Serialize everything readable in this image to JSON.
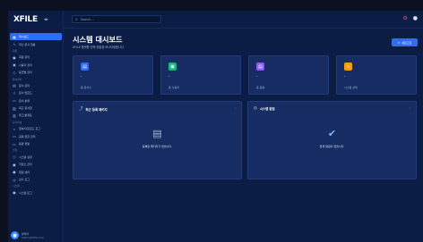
{
  "brand": {
    "logo": "XFILE",
    "toggle": "◂▸"
  },
  "sidebar": {
    "items": [
      {
        "kind": "item",
        "label": "대시보드",
        "icon": "grid-icon",
        "glyph": "▦",
        "active": true
      },
      {
        "kind": "item",
        "label": "최신 문서 현황",
        "icon": "activity-icon",
        "glyph": "∿"
      },
      {
        "kind": "section",
        "label": "회원"
      },
      {
        "kind": "item",
        "label": "회원 관리",
        "icon": "users-icon",
        "glyph": "●"
      },
      {
        "kind": "item",
        "label": "사용자 관리",
        "icon": "user-icon",
        "glyph": "▣"
      },
      {
        "kind": "item",
        "label": "등급별 관리",
        "icon": "shield-icon",
        "glyph": "◇"
      },
      {
        "kind": "section",
        "label": "문서관리"
      },
      {
        "kind": "item",
        "label": "문서 관리",
        "icon": "file-icon",
        "glyph": "▤"
      },
      {
        "kind": "item",
        "label": "문서 업로드",
        "icon": "upload-icon",
        "glyph": "⇧"
      },
      {
        "kind": "item",
        "label": "문서 분류",
        "icon": "folder-icon",
        "glyph": "▭"
      },
      {
        "kind": "item",
        "label": "최근 문서함",
        "icon": "recent-icon",
        "glyph": "▧"
      },
      {
        "kind": "item",
        "label": "태그/분류표",
        "icon": "tag-icon",
        "glyph": "▥"
      },
      {
        "kind": "section",
        "label": "모니터링"
      },
      {
        "kind": "item",
        "label": "접속/다운로드 로그",
        "icon": "search-icon",
        "glyph": "⌕"
      },
      {
        "kind": "item",
        "label": "공유/권한 관리",
        "icon": "share-icon",
        "glyph": "▭"
      },
      {
        "kind": "item",
        "label": "용량 현황",
        "icon": "storage-icon",
        "glyph": "▭"
      },
      {
        "kind": "section",
        "label": "설정"
      },
      {
        "kind": "item",
        "label": "시스템 설정",
        "icon": "settings-icon",
        "glyph": "◇"
      },
      {
        "kind": "item",
        "label": "저장소 관리",
        "icon": "database-icon",
        "glyph": "●"
      },
      {
        "kind": "item",
        "label": "알림 센터",
        "icon": "bell-icon",
        "glyph": "●"
      },
      {
        "kind": "item",
        "label": "감사 로그",
        "icon": "audit-icon",
        "glyph": "◎"
      },
      {
        "kind": "section",
        "label": "시스템"
      },
      {
        "kind": "item",
        "label": "시스템 로그",
        "icon": "system-icon",
        "glyph": "●"
      }
    ]
  },
  "profile": {
    "name": "관리자",
    "email": "admin@xfile.co.kr",
    "avatar": "●"
  },
  "topbar": {
    "search_placeholder": "Search...",
    "search_glyph": "⌕",
    "notify_glyph": "⚙",
    "menu_glyph": "●"
  },
  "page": {
    "title": "시스템 대시보드",
    "subtitle": "XFILE 플랫폼 전체 현황을 모니터링합니다.",
    "refresh_label": "새로고침",
    "refresh_glyph": "⟳"
  },
  "stats": [
    {
      "label": "총 문서수",
      "value": "-",
      "icon": "file-icon",
      "glyph": "▤",
      "color": "#2f6df6"
    },
    {
      "label": "총 사용자",
      "value": "-",
      "icon": "users-icon",
      "glyph": "▣",
      "color": "#10b981"
    },
    {
      "label": "총 용량",
      "value": "-",
      "icon": "storage-icon",
      "glyph": "▤",
      "color": "#8b5cf6"
    },
    {
      "label": "시스템 상태",
      "value": "-",
      "icon": "pulse-icon",
      "glyph": "∿",
      "color": "#f59e0b"
    }
  ],
  "panels": {
    "recent": {
      "title": "최근 등록 패키지",
      "glyph": "⤴",
      "more": "›",
      "empty_glyph": "▤",
      "empty_text": "등록된 패키지가 없습니다."
    },
    "alerts": {
      "title": "시스템 알림",
      "glyph": "◎",
      "more": "›",
      "empty_glyph": "✔",
      "empty_text": "현재 알림이 없습니다."
    }
  },
  "colors": {
    "accent": "#2f6df6",
    "sidebar_bg": "#0b1d45",
    "card_bg": "#162c63"
  }
}
